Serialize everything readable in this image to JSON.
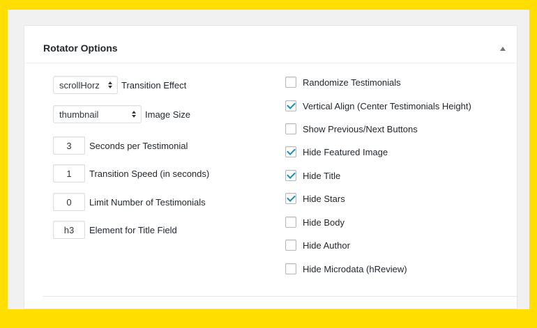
{
  "panel": {
    "title": "Rotator Options"
  },
  "left": {
    "transition_effect": {
      "value": "scrollHorz",
      "label": "Transition Effect"
    },
    "image_size": {
      "value": "thumbnail",
      "label": "Image Size"
    },
    "seconds_per": {
      "value": "3",
      "label": "Seconds per Testimonial"
    },
    "transition_speed": {
      "value": "1",
      "label": "Transition Speed (in seconds)"
    },
    "limit_number": {
      "value": "0",
      "label": "Limit Number of Testimonials"
    },
    "title_element": {
      "value": "h3",
      "label": "Element for Title Field"
    }
  },
  "right": {
    "options": [
      {
        "label": "Randomize Testimonials",
        "checked": false
      },
      {
        "label": "Vertical Align (Center Testimonials Height)",
        "checked": true
      },
      {
        "label": "Show Previous/Next Buttons",
        "checked": false
      },
      {
        "label": "Hide Featured Image",
        "checked": true
      },
      {
        "label": "Hide Title",
        "checked": true
      },
      {
        "label": "Hide Stars",
        "checked": true
      },
      {
        "label": "Hide Body",
        "checked": false
      },
      {
        "label": "Hide Author",
        "checked": false
      },
      {
        "label": "Hide Microdata (hReview)",
        "checked": false
      }
    ]
  },
  "colors": {
    "frame": "#ffde00",
    "checkmark": "#1e8cbe"
  },
  "icons": {
    "collapse": "triangle-up-icon",
    "select_arrows": "up-down-arrows-icon"
  }
}
